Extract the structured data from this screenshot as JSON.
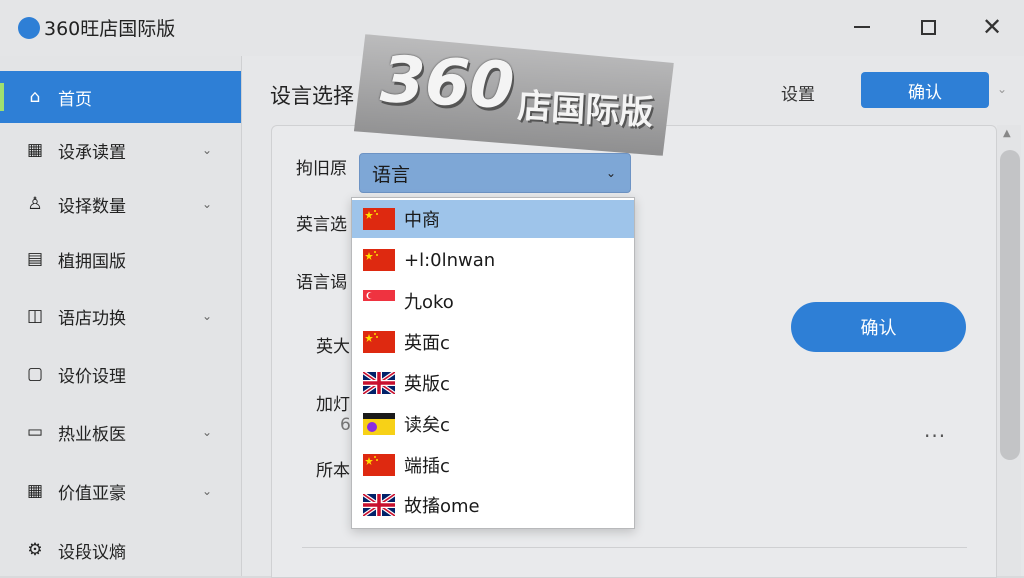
{
  "window": {
    "title": "360旺店国际版",
    "minimize_icon": "minimize-icon",
    "maximize_icon": "maximize-icon",
    "close_glyph": "✕"
  },
  "sidebar": {
    "items": [
      {
        "label": "首页",
        "icon": "home-icon",
        "glyph": "⌂",
        "active": true,
        "has_chevron": false
      },
      {
        "label": "设承读置",
        "icon": "grid-icon",
        "glyph": "▦",
        "active": false,
        "has_chevron": true
      },
      {
        "label": "设择数量",
        "icon": "user-icon",
        "glyph": "♙",
        "active": false,
        "has_chevron": true
      },
      {
        "label": "植拥国版",
        "icon": "document-icon",
        "glyph": "▤",
        "active": false,
        "has_chevron": false
      },
      {
        "label": "语店功换",
        "icon": "chart-icon",
        "glyph": "◫",
        "active": false,
        "has_chevron": true
      },
      {
        "label": "设价设理",
        "icon": "file-icon",
        "glyph": "▢",
        "active": false,
        "has_chevron": false
      },
      {
        "label": "热业板医",
        "icon": "laptop-icon",
        "glyph": "▭",
        "active": false,
        "has_chevron": true
      },
      {
        "label": "价值亚豪",
        "icon": "apps-icon",
        "glyph": "▦",
        "active": false,
        "has_chevron": true
      },
      {
        "label": "设段议熵",
        "icon": "settings-icon",
        "glyph": "⚙",
        "active": false,
        "has_chevron": false
      }
    ],
    "chevron_glyph": "⌄"
  },
  "header": {
    "title": "设言选择",
    "settings_label": "设置",
    "confirm_label": "确认",
    "caret_glyph": "⌄"
  },
  "form": {
    "labels": [
      "拘旧原",
      "英言选",
      "语言谒",
      "英大",
      "加灯",
      "所本"
    ],
    "select_value": "语言",
    "caret_glyph": "⌄",
    "round_button_label": "确认",
    "more_glyph": "···",
    "partial_glyph": "6"
  },
  "dropdown": {
    "options": [
      {
        "label": "中商",
        "flag": "china-flag-icon",
        "selected": true
      },
      {
        "label": "+l:0lnwan",
        "flag": "china-flag-icon",
        "selected": false
      },
      {
        "label": "九oko",
        "flag": "singapore-flag-icon",
        "selected": false
      },
      {
        "label": "英面c",
        "flag": "china-flag-icon",
        "selected": false
      },
      {
        "label": "英版c",
        "flag": "uk-flag-icon",
        "selected": false
      },
      {
        "label": "读矣c",
        "flag": "yellow-purple-flag-icon",
        "selected": false
      },
      {
        "label": "端插c",
        "flag": "china-flag-icon",
        "selected": false
      },
      {
        "label": "故搐ome",
        "flag": "uk-flag-icon",
        "selected": false
      }
    ]
  },
  "watermark": {
    "number": "360",
    "text": "店国际版"
  },
  "colors": {
    "accent": "#2e7fd6",
    "selected_option": "#9ec4ea",
    "select_bg": "#7ea7d6"
  }
}
